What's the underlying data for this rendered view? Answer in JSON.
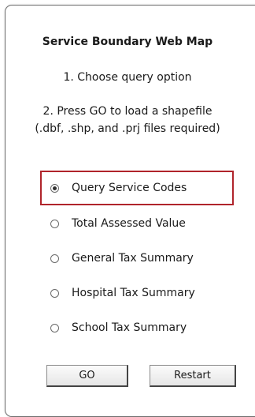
{
  "panel": {
    "title": "Service Boundary Web Map",
    "step1": "1. Choose query option",
    "step2_line1": "2. Press GO to load a shapefile",
    "step2_line2": "(.dbf, .shp, and .prj files required)"
  },
  "query_options": [
    {
      "label": "Query Service Codes",
      "selected": true
    },
    {
      "label": "Total Assessed Value",
      "selected": false
    },
    {
      "label": "General Tax Summary",
      "selected": false
    },
    {
      "label": "Hospital Tax Summary",
      "selected": false
    },
    {
      "label": "School Tax Summary",
      "selected": false
    }
  ],
  "buttons": {
    "go_label": "GO",
    "restart_label": "Restart"
  },
  "colors": {
    "highlight_border": "#b0242b",
    "panel_border": "#6f6f6f"
  }
}
